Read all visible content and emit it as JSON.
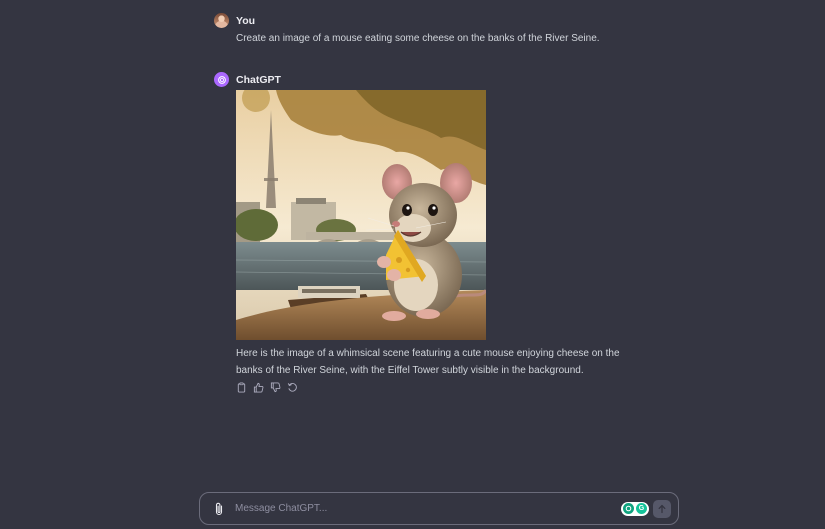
{
  "conversation": {
    "user": {
      "author": "You",
      "text": "Create an image of a mouse eating some cheese on the banks of the River Seine."
    },
    "assistant": {
      "author": "ChatGPT",
      "image_subject": "Cartoon mouse holding a wedge of cheese on the banks of the River Seine, Eiffel Tower and a boat in the background",
      "text": "Here is the image of a whimsical scene featuring a cute mouse enjoying cheese on the banks of the River Seine, with the Eiffel Tower subtly visible in the background.",
      "actions": [
        "copy-icon",
        "thumbs-up-icon",
        "thumbs-down-icon",
        "regenerate-icon"
      ]
    }
  },
  "composer": {
    "placeholder": "Message ChatGPT...",
    "extension_icons": [
      "green-extension-icon",
      "grammarly-icon"
    ],
    "extension_letter": "G"
  },
  "colors": {
    "background": "#343541",
    "assistant_avatar": "#ab68ff",
    "send_button": "#565869"
  }
}
